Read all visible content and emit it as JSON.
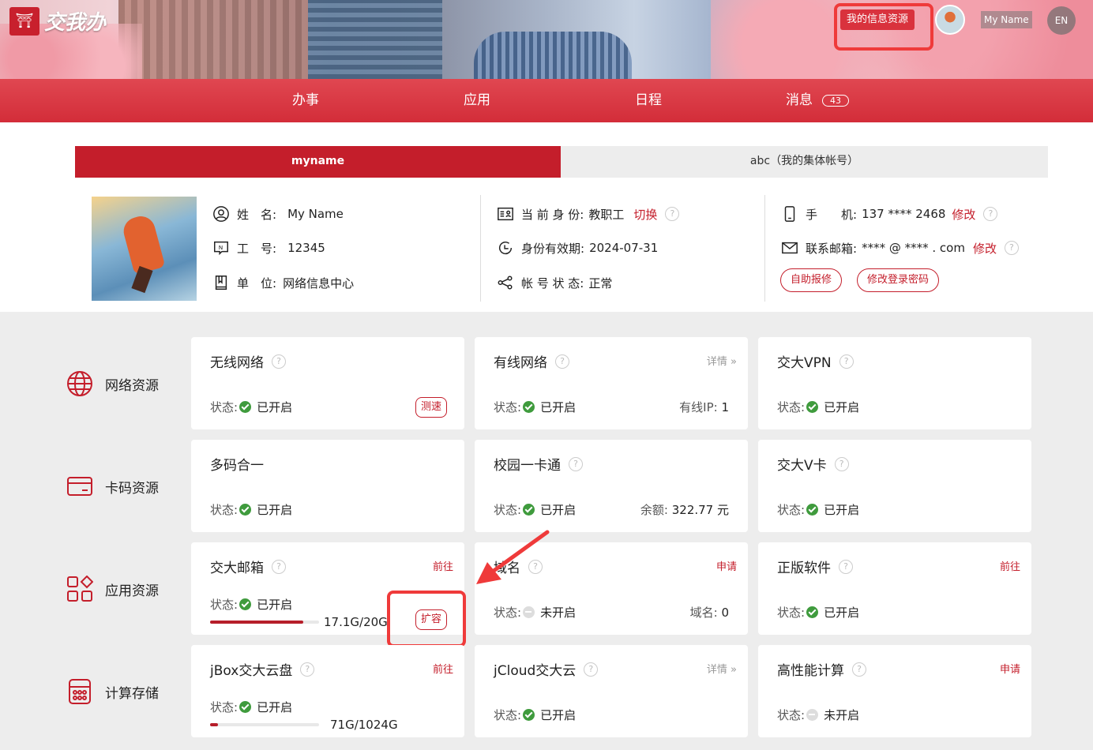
{
  "header": {
    "logo_text": "交我办",
    "my_info_label": "我的信息资源",
    "user_name": "My Name",
    "lang": "EN"
  },
  "nav": [
    {
      "label": "办事"
    },
    {
      "label": "应用"
    },
    {
      "label": "日程"
    },
    {
      "label": "消息",
      "badge": "43"
    }
  ],
  "tabs": {
    "active": "myname",
    "other": "abc（我的集体帐号）"
  },
  "profile": {
    "name_label": "姓　名:",
    "name": "My Name",
    "id_label": "工　号:",
    "id": "12345",
    "unit_label": "单　位:",
    "unit": "网络信息中心",
    "identity_label": "当 前 身 份:",
    "identity": "教职工",
    "switch_label": "切换",
    "validity_label": "身份有效期:",
    "validity": "2024-07-31",
    "account_label": "帐 号 状 态:",
    "account": "正常",
    "phone_label": "手　　机:",
    "phone": "137 **** 2468",
    "phone_edit": "修改",
    "email_label": "联系邮箱:",
    "email": "**** @ **** . com",
    "email_edit": "修改",
    "repair_btn": "自助报修",
    "pwd_btn": "修改登录密码"
  },
  "categories": [
    {
      "label": "网络资源",
      "icon": "globe-icon"
    },
    {
      "label": "卡码资源",
      "icon": "card-icon"
    },
    {
      "label": "应用资源",
      "icon": "apps-icon"
    },
    {
      "label": "计算存储",
      "icon": "compute-icon"
    }
  ],
  "status_label": "状态:",
  "cards": {
    "wifi": {
      "title": "无线网络",
      "status": "已开启",
      "action": "测速"
    },
    "wired": {
      "title": "有线网络",
      "link": "详情",
      "status": "已开启",
      "extra_label": "有线IP:",
      "extra_value": "1"
    },
    "vpn": {
      "title": "交大VPN",
      "status": "已开启"
    },
    "multicode": {
      "title": "多码合一",
      "status": "已开启"
    },
    "campuscard": {
      "title": "校园一卡通",
      "status": "已开启",
      "extra_label": "余额:",
      "extra_value": "322.77 元"
    },
    "vcard": {
      "title": "交大V卡",
      "status": "已开启"
    },
    "mail": {
      "title": "交大邮箱",
      "link": "前往",
      "status": "已开启",
      "usage": "17.1G/20G",
      "action": "扩容",
      "fill_fraction": 0.855
    },
    "domain": {
      "title": "域名",
      "link": "申请",
      "status": "未开启",
      "extra_label": "域名:",
      "extra_value": "0"
    },
    "software": {
      "title": "正版软件",
      "link": "前往",
      "status": "已开启"
    },
    "jbox": {
      "title": "jBox交大云盘",
      "link": "前往",
      "status": "已开启",
      "usage": "71G/1024G",
      "fill_fraction": 0.07
    },
    "jcloud": {
      "title": "jCloud交大云",
      "link": "详情",
      "status": "已开启"
    },
    "hpc": {
      "title": "高性能计算",
      "link": "申请",
      "status": "未开启"
    }
  },
  "colors": {
    "brand": "#c41e2b",
    "ok": "#3f9b3d",
    "annotation": "#ef3a3a"
  }
}
